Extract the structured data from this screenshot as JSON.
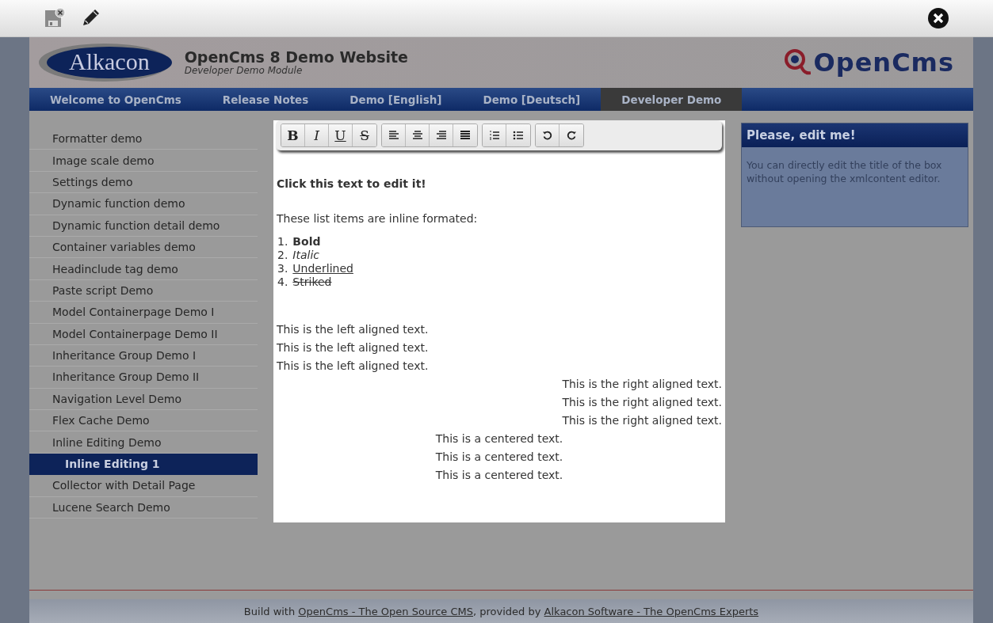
{
  "editor_toolbar": {
    "buttons": [
      {
        "kind": "save-disabled"
      },
      {
        "kind": "edit"
      }
    ],
    "close": {
      "kind": "close"
    }
  },
  "header": {
    "logo_text": "Alkacon",
    "title": "OpenCms 8 Demo Website",
    "subtitle": "Developer Demo Module",
    "brand": "OpenCms"
  },
  "nav": [
    {
      "label": "Welcome to OpenCms",
      "selected": false
    },
    {
      "label": "Release Notes",
      "selected": false
    },
    {
      "label": "Demo [English]",
      "selected": false
    },
    {
      "label": "Demo [Deutsch]",
      "selected": false
    },
    {
      "label": "Developer Demo",
      "selected": true
    }
  ],
  "sidebar": {
    "items": [
      {
        "label": "Formatter demo",
        "selected": false
      },
      {
        "label": "Image scale demo",
        "selected": false
      },
      {
        "label": "Settings demo",
        "selected": false
      },
      {
        "label": "Dynamic function demo",
        "selected": false
      },
      {
        "label": "Dynamic function detail demo",
        "selected": false
      },
      {
        "label": "Container variables demo",
        "selected": false
      },
      {
        "label": "Headinclude tag demo",
        "selected": false
      },
      {
        "label": "Paste script Demo",
        "selected": false
      },
      {
        "label": "Model Containerpage Demo I",
        "selected": false
      },
      {
        "label": "Model Containerpage Demo II",
        "selected": false
      },
      {
        "label": "Inheritance Group Demo I",
        "selected": false
      },
      {
        "label": "Inheritance Group Demo II",
        "selected": false
      },
      {
        "label": "Navigation Level Demo",
        "selected": false
      },
      {
        "label": "Flex Cache Demo",
        "selected": false
      },
      {
        "label": "Inline Editing Demo",
        "selected": false,
        "children": [
          {
            "label": "Inline Editing 1",
            "selected": true
          }
        ]
      },
      {
        "label": "Collector with Detail Page",
        "selected": false
      },
      {
        "label": "Lucene Search Demo",
        "selected": false
      }
    ]
  },
  "format_toolbar": {
    "groups": [
      [
        {
          "kind": "bold",
          "label": "B"
        },
        {
          "kind": "italic",
          "label": "I"
        },
        {
          "kind": "underline",
          "label": "U"
        },
        {
          "kind": "strike",
          "label": "S"
        }
      ],
      [
        {
          "kind": "align-left"
        },
        {
          "kind": "align-center"
        },
        {
          "kind": "align-right"
        },
        {
          "kind": "align-justify"
        }
      ],
      [
        {
          "kind": "numbered-list"
        },
        {
          "kind": "bullet-list"
        }
      ],
      [
        {
          "kind": "undo"
        },
        {
          "kind": "redo"
        }
      ]
    ]
  },
  "content": {
    "heading": "Click this text to edit it!",
    "intro": "These list items are inline formated:",
    "list": [
      {
        "number": "1.",
        "text": "Bold",
        "kind": "bold"
      },
      {
        "number": "2.",
        "text": "Italic",
        "kind": "italic"
      },
      {
        "number": "3.",
        "text": "Underlined",
        "kind": "underline"
      },
      {
        "number": "4.",
        "text": "Striked",
        "kind": "strike"
      }
    ],
    "lines": [
      {
        "text": "This is the left aligned text.",
        "kind": "left"
      },
      {
        "text": "This is the left aligned text.",
        "kind": "left"
      },
      {
        "text": "This is the left aligned text.",
        "kind": "left"
      },
      {
        "text": "This is the right aligned text.",
        "kind": "right"
      },
      {
        "text": "This is the right aligned text.",
        "kind": "right"
      },
      {
        "text": "This is the right aligned text.",
        "kind": "right"
      },
      {
        "text": "This is a centered text.",
        "kind": "center"
      },
      {
        "text": "This is a centered text.",
        "kind": "center"
      },
      {
        "text": "This is a centered text.",
        "kind": "center"
      }
    ]
  },
  "side_box": {
    "title": "Please, edit me!",
    "text": "You can directly edit the title of the box without opening the xmlcontent editor."
  },
  "footer": {
    "prefix": "Build with ",
    "link_1": "OpenCms - The Open Source CMS",
    "middle": ", provided by ",
    "link_2": "Alkacon Software - The OpenCms Experts"
  }
}
